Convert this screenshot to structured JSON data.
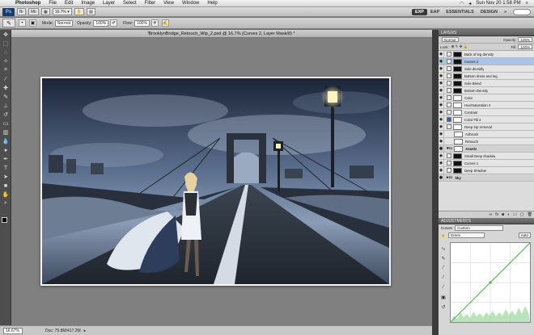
{
  "menubar": {
    "items": [
      "Photoshop",
      "File",
      "Edit",
      "Image",
      "Layer",
      "Select",
      "Filter",
      "View",
      "Window",
      "Help"
    ],
    "clock": "Sun Nov 20  1:58 PM"
  },
  "appbar": {
    "logo": "Ps",
    "zoom": "16.7%",
    "workspaces": [
      "EXP",
      "EAP",
      "ESSENTIALS",
      "DESIGN"
    ],
    "active_workspace": "EXP"
  },
  "options": {
    "mode_label": "Mode:",
    "mode_value": "Normal",
    "opacity_label": "Opacity:",
    "opacity_value": "100%",
    "flow_label": "Flow:",
    "flow_value": "100%"
  },
  "document": {
    "title": "BrooklynBridge_Retouch_Wip_2.psd @ 16.7% (Curves 2, Layer Mask/8) *",
    "close": "×"
  },
  "status": {
    "zoom": "16.67%",
    "doc": "Doc: 75.8M/417.2M"
  },
  "layers_panel": {
    "title": "LAYERS",
    "blend_mode": "Normal",
    "opacity_label": "Opacity:",
    "opacity_value": "100%",
    "lock_label": "Lock:",
    "fill_label": "Fill:",
    "fill_value": "100%",
    "layers": [
      {
        "name": "Back of leg density",
        "mask": "black",
        "selected": false,
        "group": false
      },
      {
        "name": "Curves 2",
        "mask": "black",
        "selected": true,
        "group": false
      },
      {
        "name": "Sole densitly",
        "mask": "black",
        "selected": false,
        "group": false
      },
      {
        "name": "Bottom dress and leg",
        "mask": "black",
        "selected": false,
        "group": false
      },
      {
        "name": "Sole Blend",
        "mask": "black",
        "selected": false,
        "group": false
      },
      {
        "name": "Bottom Density",
        "mask": "black",
        "selected": false,
        "group": false
      },
      {
        "name": "Color",
        "mask": "white",
        "selected": false,
        "group": false
      },
      {
        "name": "Hue/Saturation 4",
        "mask": "white",
        "selected": false,
        "group": false
      },
      {
        "name": "Contrast",
        "mask": "white",
        "selected": false,
        "group": false
      },
      {
        "name": "Color Fill 2",
        "mask": "white",
        "selected": false,
        "group": false
      },
      {
        "name": "Deep top removal",
        "mask": "white",
        "selected": false,
        "group": false
      },
      {
        "name": "Airbrush",
        "mask": "none",
        "selected": false,
        "group": false
      },
      {
        "name": "Retouch",
        "mask": "none",
        "selected": false,
        "group": false
      },
      {
        "name": "Assets",
        "mask": "white",
        "selected": false,
        "group": true
      },
      {
        "name": "Small Deep shadow",
        "mask": "black",
        "selected": false,
        "group": false
      },
      {
        "name": "Curves 1",
        "mask": "black",
        "selected": false,
        "group": false
      },
      {
        "name": "Deep Shadow",
        "mask": "black",
        "selected": false,
        "group": false
      },
      {
        "name": "Sky",
        "mask": "none",
        "selected": false,
        "group": true
      }
    ]
  },
  "adjustments_panel": {
    "title": "ADJUSTMENTS",
    "preset_label": "Curves",
    "preset_value": "Custom",
    "channel_value": "Green",
    "auto_button": "Auto"
  },
  "colors": {
    "curve_line": "#4caf50",
    "histogram": "#9ed79e",
    "selection": "#a9c4e6",
    "sky_dark": "#1b2438",
    "sky_light": "#7f92ad"
  }
}
